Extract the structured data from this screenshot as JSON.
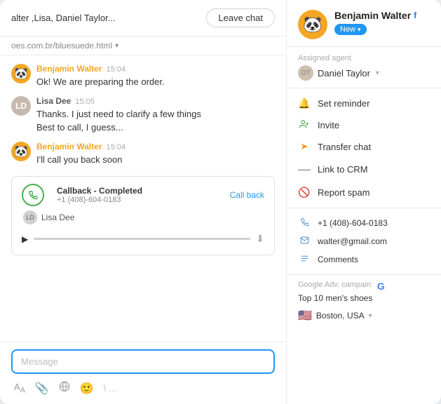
{
  "header": {
    "title": "alter ,Lisa, Daniel Taylor...",
    "leave_chat_label": "Leave chat",
    "url": "oes.com.br/bluesuede.html"
  },
  "messages": [
    {
      "id": "msg1",
      "author": "Benjamin Walter",
      "author_type": "agent",
      "time": "15:04",
      "text": "Ok! We are preparing the order."
    },
    {
      "id": "msg2",
      "author": "Lisa Dee",
      "author_type": "customer",
      "time": "15:05",
      "text": "Thanks. I just need to clarify a few things\nBest to call, I guess..."
    },
    {
      "id": "msg3",
      "author": "Benjamin Walter",
      "author_type": "agent",
      "time": "15:04",
      "text": "I'll call you back soon"
    }
  ],
  "callback_card": {
    "title": "Callback - Completed",
    "phone": "+1 (408)-604-0183",
    "call_back_label": "Call back",
    "user_name": "Lisa Dee"
  },
  "input": {
    "placeholder": "Message"
  },
  "toolbar": {
    "icons": [
      "Aa",
      "📎",
      "🌐",
      "🙂",
      "\\..."
    ]
  },
  "contact": {
    "name": "Benjamin Walter",
    "fb_label": "f",
    "badge_label": "New",
    "assigned_label": "Assigned agent",
    "agent_name": "Daniel Taylor"
  },
  "actions": [
    {
      "id": "set-reminder",
      "icon": "🔔",
      "label": "Set reminder",
      "icon_color": "#f5a623"
    },
    {
      "id": "invite",
      "icon": "👤",
      "label": "Invite",
      "icon_color": "#4caf50"
    },
    {
      "id": "transfer-chat",
      "icon": "➤",
      "label": "Transfer chat",
      "icon_color": "#ff9800"
    },
    {
      "id": "link-to-crm",
      "icon": "—",
      "label": "Link to CRM",
      "icon_color": "#78909c"
    },
    {
      "id": "report-spam",
      "icon": "🚫",
      "label": "Report spam",
      "icon_color": "#f44336"
    }
  ],
  "contact_details": [
    {
      "id": "phone",
      "icon": "📞",
      "text": "+1 (408)-604-0183"
    },
    {
      "id": "email",
      "icon": "✉",
      "text": "walter@gmail.com"
    },
    {
      "id": "comments",
      "icon": "☰",
      "text": "Comments"
    }
  ],
  "campaign": {
    "label": "Google Adv. campain:",
    "g_text": "G",
    "text": "Top 10 men's shoes"
  },
  "location": {
    "flag": "🇺🇸",
    "text": "Boston, USA"
  }
}
